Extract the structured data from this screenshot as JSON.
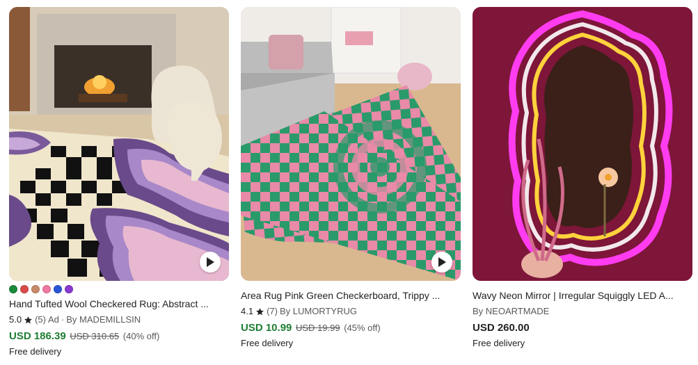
{
  "listings": [
    {
      "swatches": [
        "#1a8a3a",
        "#d94a4a",
        "#c98a6a",
        "#f07aa0",
        "#2a55d6",
        "#8a3ad0"
      ],
      "title": "Hand Tufted Wool Checkered Rug: Abstract ...",
      "rating": "5.0",
      "reviews": "(5)",
      "ad": "Ad",
      "separator": "·",
      "shop": "By MADEMILLSIN",
      "price": "USD 186.39",
      "original_price": "USD 310.65",
      "discount": "(40% off)",
      "delivery": "Free delivery",
      "has_video": true,
      "icon": "play-icon"
    },
    {
      "title": "Area Rug Pink Green Checkerboard, Trippy ...",
      "rating": "4.1",
      "reviews": "(7)",
      "shop": "By LUMORTYRUG",
      "price": "USD 10.99",
      "original_price": "USD 19.99",
      "discount": "(45% off)",
      "delivery": "Free delivery",
      "has_video": true,
      "icon": "play-icon"
    },
    {
      "title": "Wavy Neon Mirror | Irregular Squiggly LED A...",
      "shop": "By NEOARTMADE",
      "price": "USD 260.00",
      "delivery": "Free delivery",
      "has_video": false
    }
  ],
  "colors": {
    "sale_green": "#1e7e34",
    "text": "#222222",
    "muted": "#595959"
  }
}
